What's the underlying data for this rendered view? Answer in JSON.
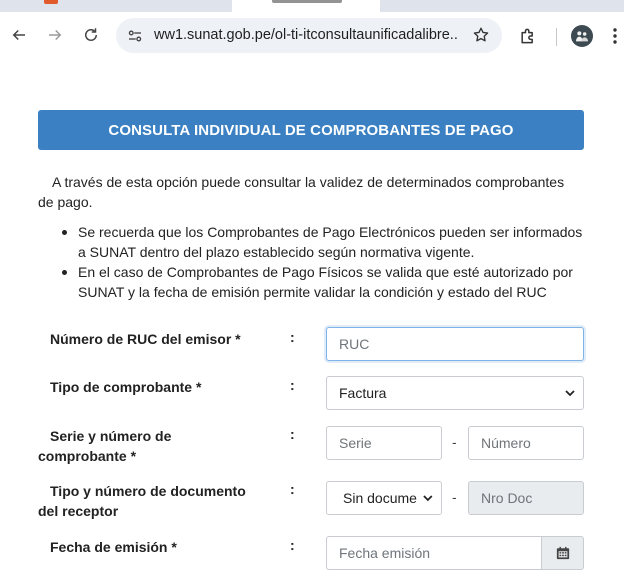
{
  "browser": {
    "url": "ww1.sunat.gob.pe/ol-ti-itconsultaunificadalibre..."
  },
  "page": {
    "banner_title": "CONSULTA INDIVIDUAL DE COMPROBANTES DE PAGO",
    "intro": "A través de esta opción puede consultar la validez de determinados comprobantes de pago.",
    "bullets": [
      "Se recuerda que los Comprobantes de Pago Electrónicos pueden ser informados a SUNAT dentro del plazo establecido según normativa vigente.",
      "En el caso de Comprobantes de Pago Físicos se valida que esté autorizado por SUNAT y la fecha de emisión permite validar la condición y estado del RUC"
    ]
  },
  "form": {
    "colon": ":",
    "dash": "-",
    "ruc": {
      "label": "Número de RUC del emisor *",
      "placeholder": "RUC"
    },
    "tipo_comprobante": {
      "label": "Tipo de comprobante *",
      "value": "Factura"
    },
    "serie_numero": {
      "label": "Serie y número de comprobante *",
      "serie_placeholder": "Serie",
      "numero_placeholder": "Número"
    },
    "receptor": {
      "label": "Tipo y número de documento del receptor",
      "tipo_value": "Sin docume",
      "nro_placeholder": "Nro Doc"
    },
    "fecha": {
      "label": "Fecha de emisión *",
      "placeholder": "Fecha emisión"
    }
  },
  "icons": {
    "back": "arrow-left-icon",
    "forward": "arrow-right-icon",
    "reload": "reload-icon",
    "site_info": "site-settings-icon",
    "bookmark": "star-icon",
    "extensions": "puzzle-icon",
    "profile": "avatar-icon",
    "menu": "kebab-menu-icon",
    "calendar": "calendar-icon"
  },
  "colors": {
    "banner": "#3a80c2",
    "focus_border": "#7fb2e5",
    "omnibox_bg": "#eef1f6"
  }
}
